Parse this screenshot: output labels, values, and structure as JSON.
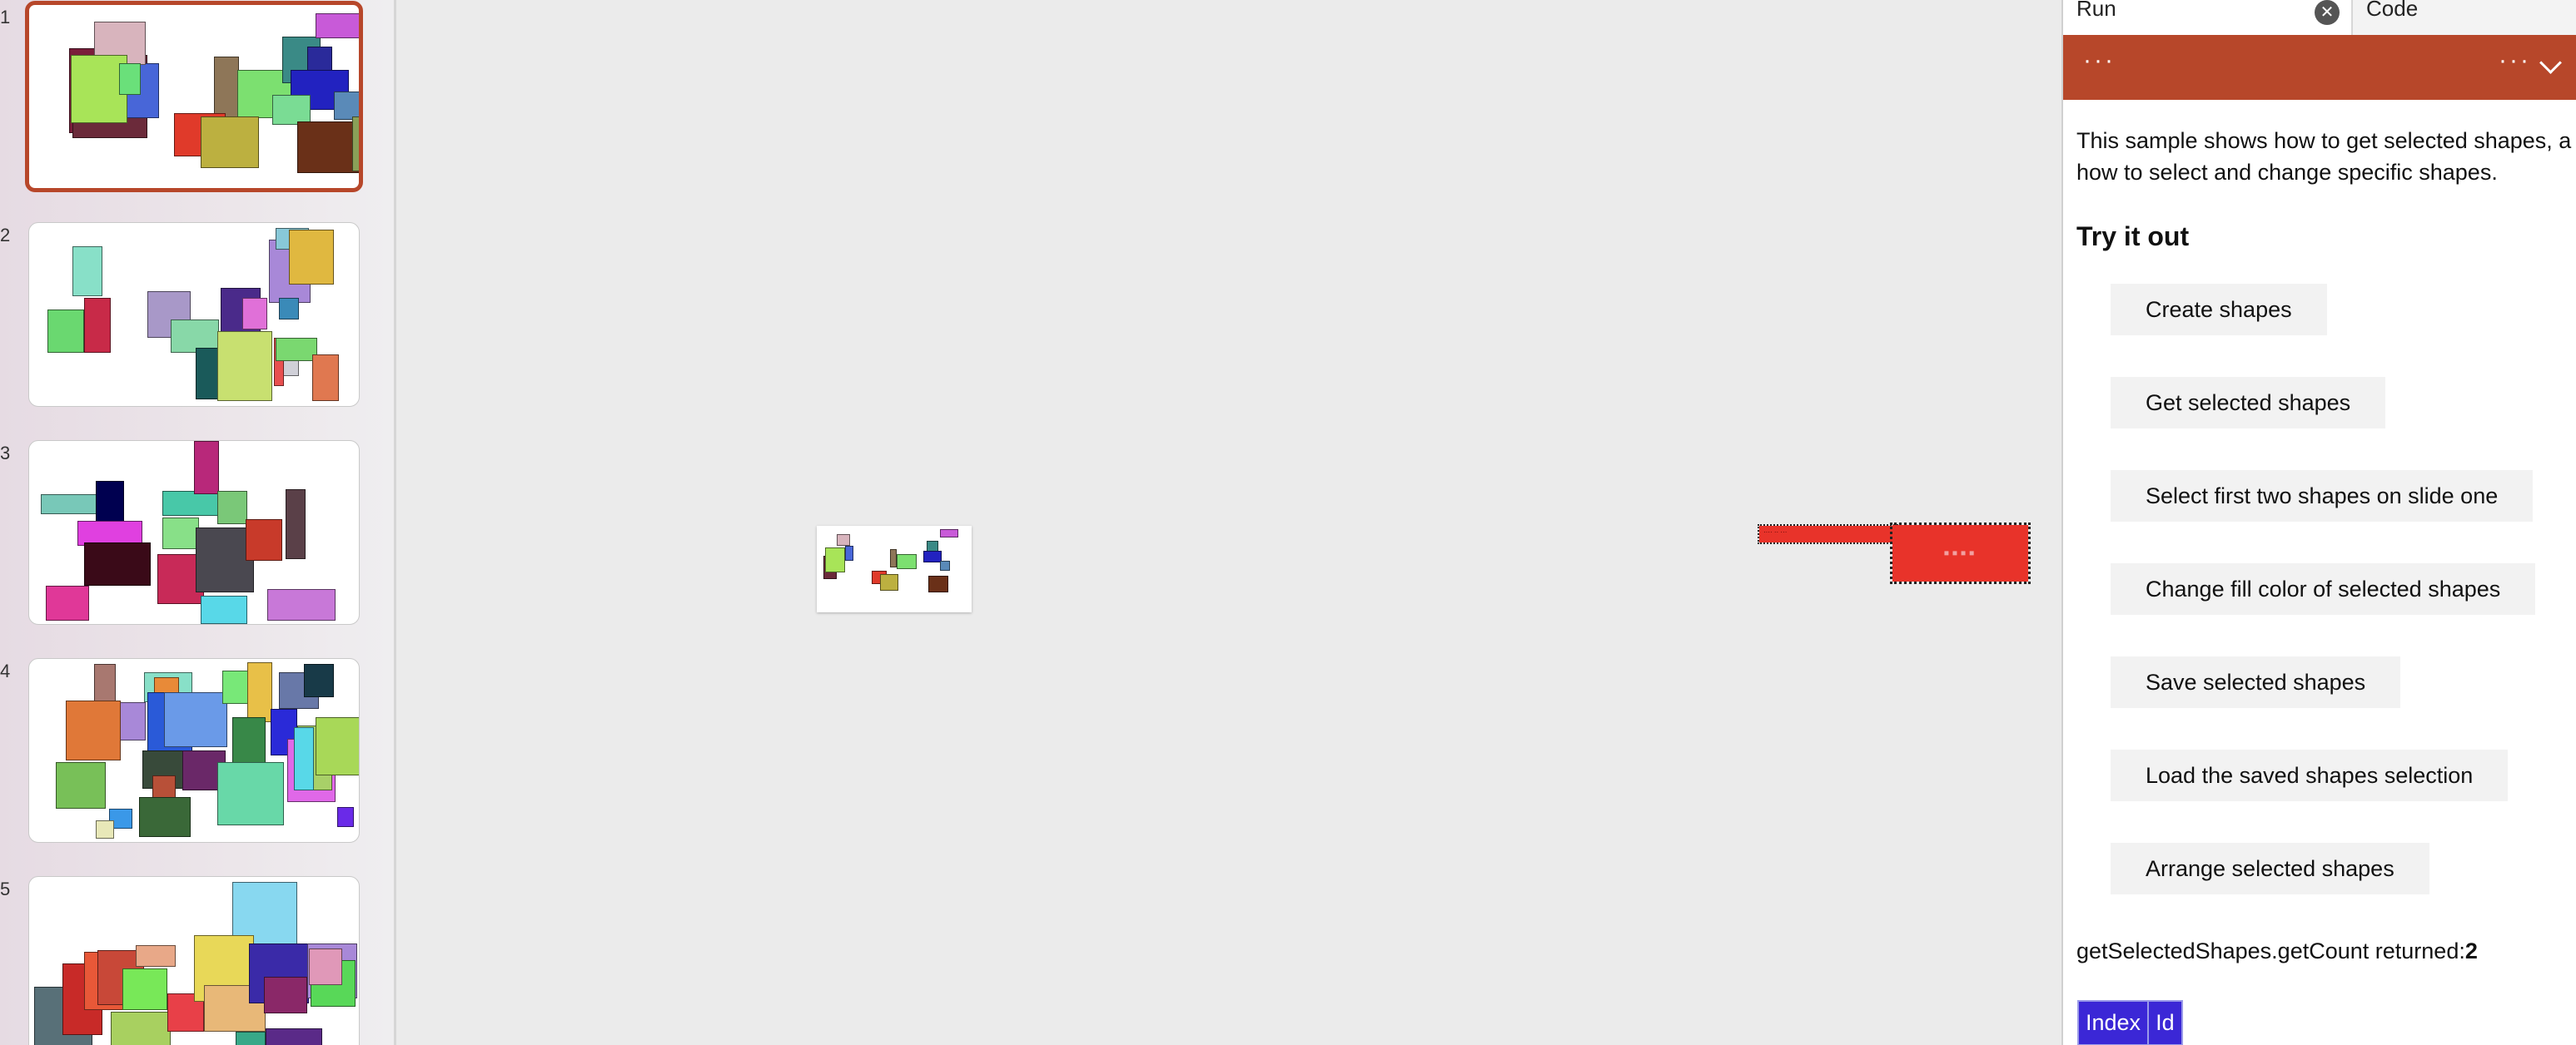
{
  "thumbnails": [
    {
      "number": "1",
      "selected": true
    },
    {
      "number": "2",
      "selected": false
    },
    {
      "number": "3",
      "selected": false
    },
    {
      "number": "4",
      "selected": false
    },
    {
      "number": "5",
      "selected": false
    }
  ],
  "task_pane": {
    "tabs": {
      "run": "Run",
      "code": "Code"
    },
    "close_glyph": "✕",
    "banner": {
      "left_menu": "···",
      "right_menu": "···"
    },
    "description": "This sample shows how to get selected shapes, a how to select and change specific shapes.",
    "description_line1": "This sample shows how to get selected shapes, a",
    "description_line2": "how to select and change specific shapes.",
    "try_heading": "Try it out",
    "buttons": [
      "Create shapes",
      "Get selected shapes",
      "Select first two shapes on slide one",
      "Change fill color of selected shapes",
      "Save selected shapes",
      "Load the saved shapes selection",
      "Arrange selected shapes"
    ],
    "result_prefix": "getSelectedShapes.getCount returned:",
    "result_value": "2",
    "table_headers": [
      "Index",
      "Id"
    ]
  },
  "colors": {
    "accent": "#b7472a",
    "table_header": "#3b27d6",
    "selected_shape_fill": "#e8332a"
  }
}
